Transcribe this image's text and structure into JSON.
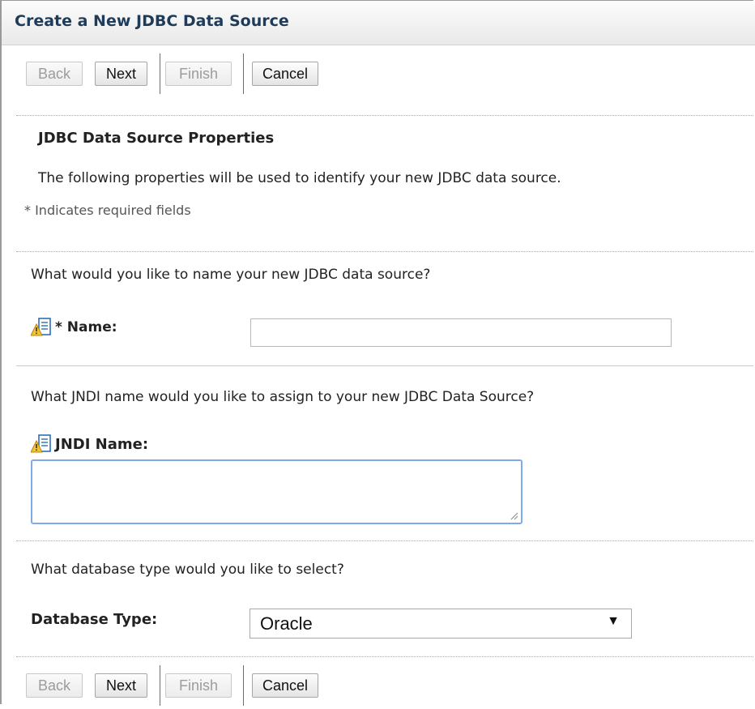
{
  "window": {
    "title": "Create a New JDBC Data Source"
  },
  "buttons": {
    "back": "Back",
    "next": "Next",
    "finish": "Finish",
    "cancel": "Cancel"
  },
  "section": {
    "heading": "JDBC Data Source Properties",
    "description": "The following properties will be used to identify your new JDBC data source.",
    "required_note": "* Indicates required fields"
  },
  "name_field": {
    "question": "What would you like to name your new JDBC data source?",
    "label": "* Name:",
    "value": "",
    "icon": "warning-info-icon"
  },
  "jndi_field": {
    "question": "What JNDI name would you like to assign to your new JDBC Data Source?",
    "label": "JNDI Name:",
    "value": "",
    "icon": "warning-info-icon"
  },
  "db_type_field": {
    "question": "What database type would you like to select?",
    "label": "Database Type:",
    "selected": "Oracle"
  },
  "colors": {
    "title_text": "#1e3c5a",
    "focus_border": "#7eaaf0",
    "warning_yellow": "#f5c231"
  }
}
